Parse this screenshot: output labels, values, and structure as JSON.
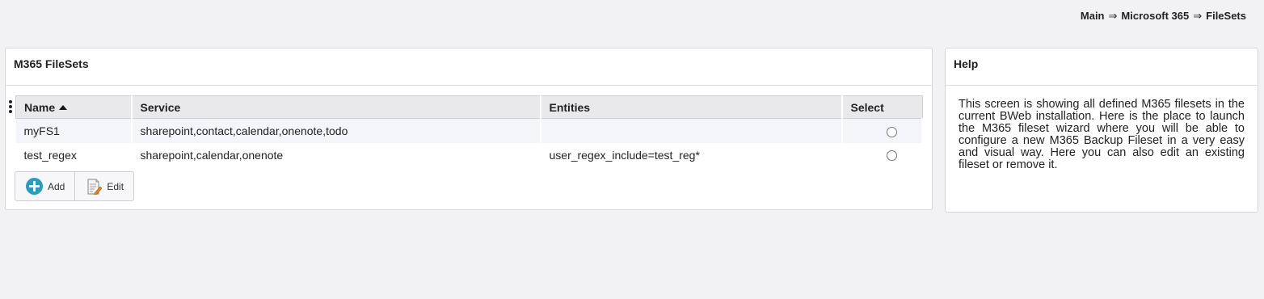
{
  "breadcrumb": {
    "items": [
      "Main",
      "Microsoft 365",
      "FileSets"
    ],
    "separator": "⇒"
  },
  "main_panel": {
    "title": "M365 FileSets",
    "table": {
      "columns": [
        "Name",
        "Service",
        "Entities",
        "Select"
      ],
      "sort": {
        "column": "Name",
        "direction": "ascending"
      },
      "rows": [
        {
          "name": "myFS1",
          "service": "sharepoint,contact,calendar,onenote,todo",
          "entities": "",
          "selected": false
        },
        {
          "name": "test_regex",
          "service": "sharepoint,calendar,onenote",
          "entities": "user_regex_include=test_reg*",
          "selected": false
        }
      ]
    },
    "buttons": {
      "add_label": "Add",
      "edit_label": "Edit"
    }
  },
  "help_panel": {
    "title": "Help",
    "text": "This screen is showing all defined M365 filesets in the current BWeb installation. Here is the place to launch the M365 fileset wizard where you will be able to configure a new M365 Backup Fileset in a very easy and visual way. Here you can also edit an existing fileset or remove it."
  },
  "colors": {
    "accent": "#2b9cb9",
    "header_bg": "#e9e9ec",
    "row_alt": "#f4f4fb",
    "page_bg": "#f2f2f4"
  },
  "icons": {
    "add": "plus-circle-icon",
    "edit": "edit-document-icon",
    "column_menu": "vertical-dots-icon",
    "sort": "sort-ascending-icon"
  }
}
